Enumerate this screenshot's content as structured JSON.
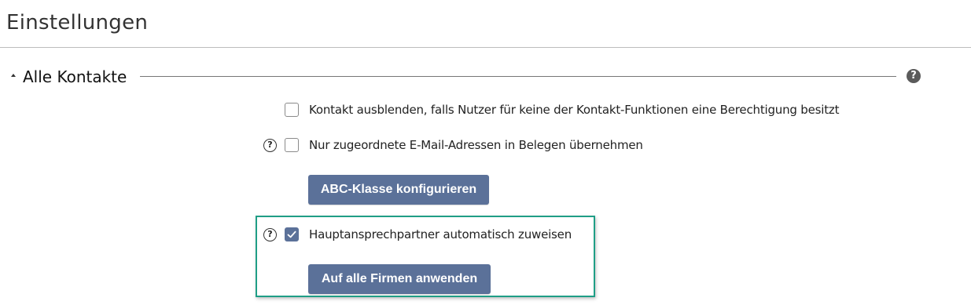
{
  "page": {
    "title": "Einstellungen"
  },
  "section": {
    "title": "Alle Kontakte",
    "help_icon": "?"
  },
  "options": [
    {
      "label": "Kontakt ausblenden, falls Nutzer für keine der Kontakt-Funktionen eine Berechtigung besitzt",
      "checked": false,
      "has_help": false
    },
    {
      "label": "Nur zugeordnete E-Mail-Adressen in Belegen übernehmen",
      "checked": false,
      "has_help": true
    },
    {
      "label": "Hauptansprechpartner automatisch zuweisen",
      "checked": true,
      "has_help": true
    }
  ],
  "buttons": {
    "abc_label": "ABC-Klasse konfigurieren",
    "apply_label": "Auf alle Firmen anwenden"
  },
  "help_glyph": "?",
  "colors": {
    "button": "#5b7199",
    "checkbox_checked": "#5b7199",
    "highlight": "#1f9e86",
    "divider": "#bdbdbd"
  }
}
